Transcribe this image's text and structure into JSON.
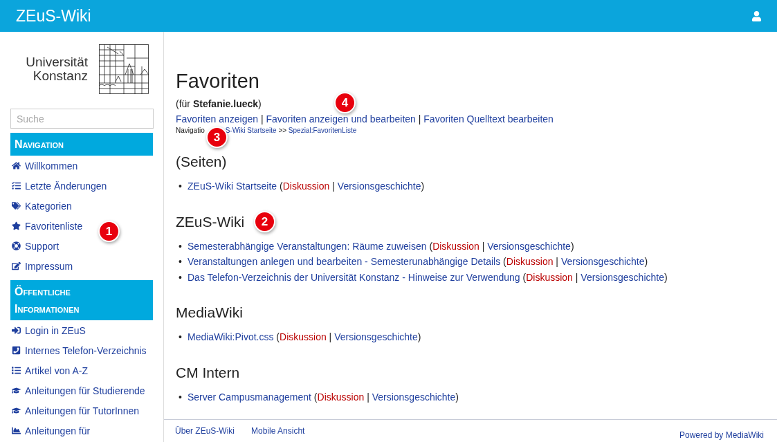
{
  "header": {
    "title": "ZEuS-Wiki"
  },
  "logo": {
    "lines": [
      "Universität",
      "Konstanz"
    ]
  },
  "search": {
    "placeholder": "Suche"
  },
  "sidebar": {
    "sections": [
      {
        "heading": "Navigation",
        "items": [
          {
            "label": "Willkommen"
          },
          {
            "label": "Letzte Änderungen"
          },
          {
            "label": "Kategorien"
          },
          {
            "label": "Favoritenliste"
          },
          {
            "label": "Support"
          },
          {
            "label": "Impressum"
          }
        ]
      },
      {
        "heading": "Öffentliche Informationen",
        "items": [
          {
            "label": "Login in ZEuS"
          },
          {
            "label": "Internes Telefon-Verzeichnis"
          },
          {
            "label": "Artikel von A-Z"
          },
          {
            "label": "Anleitungen für Studierende"
          },
          {
            "label": "Anleitungen für TutorInnen"
          },
          {
            "label": "Anleitungen für"
          }
        ]
      }
    ]
  },
  "page": {
    "title": "Favoriten",
    "subtitle": "(für **Stefanie.lueck**)",
    "actions": [
      "Favoriten anzeigen",
      "Favoriten anzeigen und bearbeiten",
      "Favoriten Quelltext bearbeiten"
    ],
    "actions_separator": "|",
    "breadcrumb": {
      "label": "Navigatio",
      "links": [
        "S-Wiki Startseite",
        "Spezial:FavoritenListe"
      ],
      "separator": ">>"
    },
    "punctuation": {
      "bullet": "•",
      "open": "(",
      "separator": "|",
      "close": ")"
    },
    "groups": [
      {
        "heading": "(Seiten)",
        "entries": [
          {
            "title": "ZEuS-Wiki Startseite",
            "talk": "Diskussion",
            "history": "Versionsgeschichte"
          }
        ]
      },
      {
        "heading": "ZEuS-Wiki",
        "entries": [
          {
            "title": "Semesterabhängige Veranstaltungen: Räume zuweisen",
            "talk": "Diskussion",
            "history": "Versionsgeschichte"
          },
          {
            "title": "Veranstaltungen anlegen und bearbeiten - Semesterunabhängige Details",
            "talk": "Diskussion",
            "history": "Versionsgeschichte"
          },
          {
            "title": "Das Telefon-Verzeichnis der Universität Konstanz - Hinweise zur Verwendung",
            "talk": "Diskussion",
            "history": "Versionsgeschichte"
          }
        ]
      },
      {
        "heading": "MediaWiki",
        "entries": [
          {
            "title": "MediaWiki:Pivot.css",
            "talk": "Diskussion",
            "history": "Versionsgeschichte"
          }
        ]
      },
      {
        "heading": "CM Intern",
        "entries": [
          {
            "title": "Server Campusmanagement",
            "talk": "Diskussion",
            "history": "Versionsgeschichte"
          }
        ]
      }
    ]
  },
  "footer": {
    "links": [
      "Über ZEuS-Wiki",
      "Mobile Ansicht"
    ],
    "powered": "Powered by MediaWiki"
  },
  "callouts": [
    {
      "number": "1"
    },
    {
      "number": "2"
    },
    {
      "number": "3"
    },
    {
      "number": "4"
    }
  ]
}
